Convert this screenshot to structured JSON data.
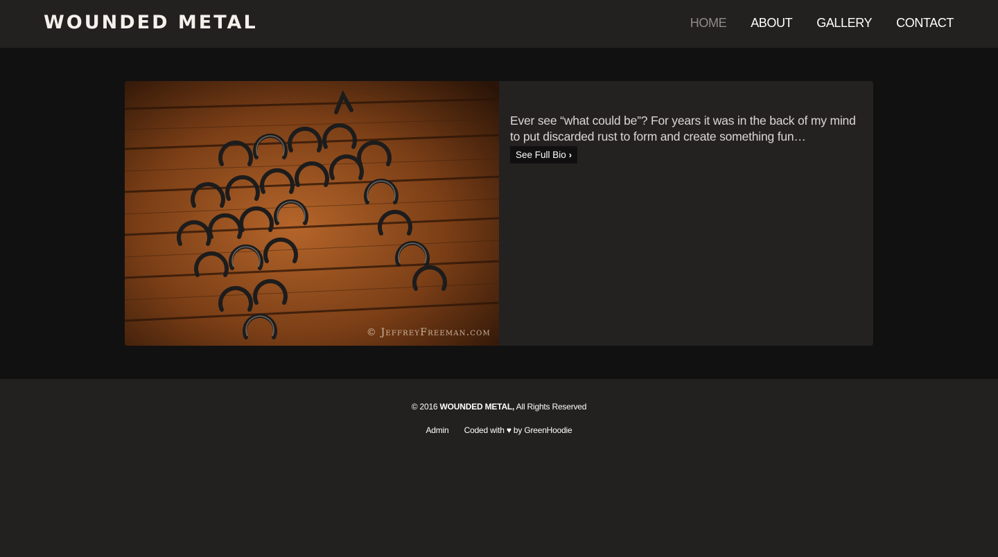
{
  "header": {
    "brand": "WOUNDED METAL",
    "nav": [
      {
        "label": "HOME",
        "active": true
      },
      {
        "label": "ABOUT",
        "active": false
      },
      {
        "label": "GALLERY",
        "active": false
      },
      {
        "label": "CONTACT",
        "active": false
      }
    ]
  },
  "feature": {
    "image_alt": "Horse head sculpture made of welded horseshoes on a wooden wall",
    "watermark": "© JeffreyFreeman.com",
    "bio_text": "Ever see “what could be”? For years it was in the back of my mind to put discarded rust to form and create something fun…",
    "bio_button": "See Full Bio",
    "bio_button_icon": "chevron-right-icon"
  },
  "footer": {
    "copyright_prefix": "© 2016",
    "copyright_brand": "WOUNDED METAL,",
    "copyright_suffix": "All Rights Reserved",
    "admin_link": "Admin",
    "coded_with": "Coded with",
    "heart_icon": "♥",
    "coded_by": "by GreenHoodie"
  },
  "colors": {
    "header_bg": "#232020",
    "content_bg": "#121111",
    "card_bg": "#242121",
    "nav_active": "#8e8b88",
    "text": "#ffffff"
  }
}
